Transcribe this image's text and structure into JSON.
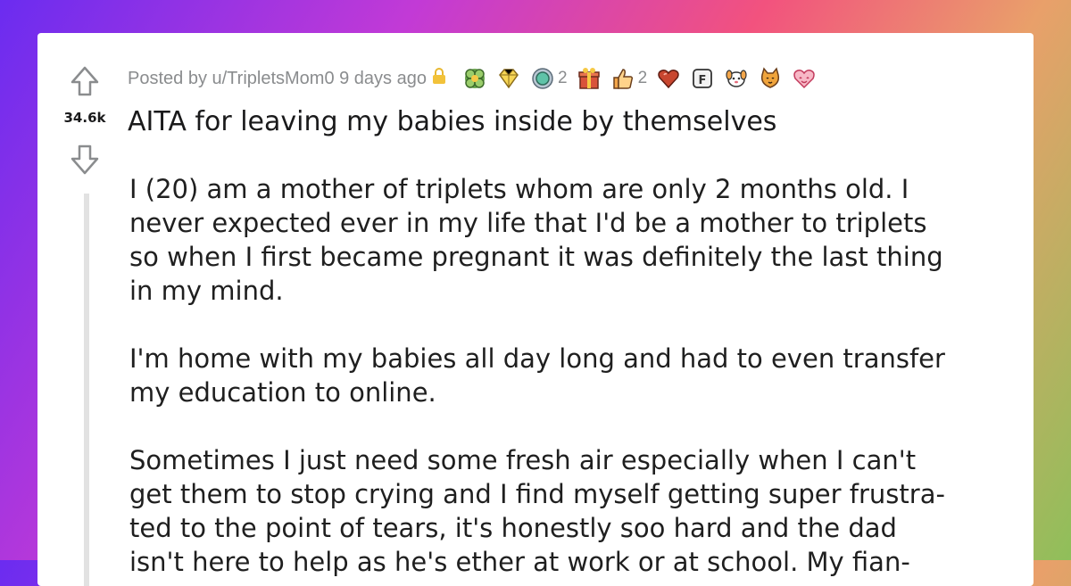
{
  "post": {
    "score": "34.6k",
    "posted_by": "Posted by u/TripletsMom0 9 days ago",
    "title": "AITA for leaving my babies inside by themselves",
    "awards": [
      {
        "name": "wholesome-seal-award-icon",
        "count": ""
      },
      {
        "name": "gem-award-icon",
        "count": ""
      },
      {
        "name": "coin-award-icon",
        "count": "2"
      },
      {
        "name": "gift-award-icon",
        "count": ""
      },
      {
        "name": "thumbs-up-award-icon",
        "count": "2"
      },
      {
        "name": "heart-award-icon",
        "count": ""
      },
      {
        "name": "press-f-award-icon",
        "count": ""
      },
      {
        "name": "dog-award-icon",
        "count": ""
      },
      {
        "name": "cat-award-icon",
        "count": ""
      },
      {
        "name": "hug-heart-award-icon",
        "count": ""
      }
    ],
    "body_lines": [
      [
        "I (20) am a mother of triplets whom are only 2 months old. I",
        "never expected ever in my life that I'd be a mother to triplets",
        "so when I first became pregnant it was definitely the last thing",
        "in my mind."
      ],
      [
        "I'm home with my babies all day long and had to even transfer",
        "my education to online."
      ],
      [
        "Sometimes I just need some fresh air especially when I can't",
        "get them to stop crying and I find myself getting super frustra-",
        "ted to the point of tears, it's honestly soo hard and the dad",
        "isn't here to help as he's ether at work or at school. My fian-"
      ]
    ]
  },
  "colors": {
    "card_bg": "#ffffff",
    "meta_text": "#8a8c8e",
    "title_text": "#1a1a1b",
    "lock": "#e8b830"
  }
}
